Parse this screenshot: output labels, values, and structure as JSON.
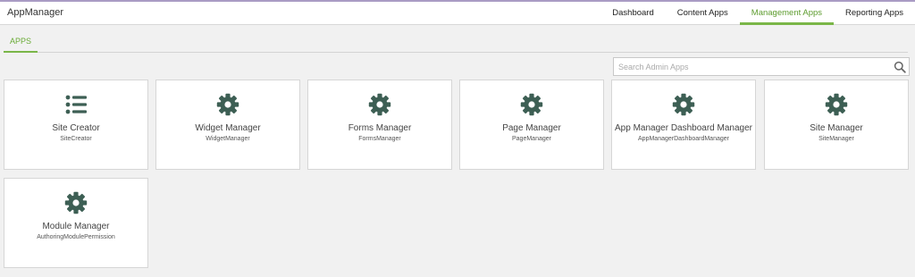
{
  "app": {
    "title": "AppManager"
  },
  "nav": {
    "items": [
      {
        "label": "Dashboard",
        "active": false
      },
      {
        "label": "Content Apps",
        "active": false
      },
      {
        "label": "Management Apps",
        "active": true
      },
      {
        "label": "Reporting Apps",
        "active": false
      }
    ]
  },
  "subtabs": {
    "apps": "APPS"
  },
  "search": {
    "placeholder": "Search Admin Apps",
    "value": ""
  },
  "colors": {
    "accent": "#7ab648",
    "icon": "#3d5f54",
    "topBorder": "#a99bc4"
  },
  "apps": [
    {
      "name": "Site Creator",
      "code": "SiteCreator",
      "icon": "list-icon"
    },
    {
      "name": "Widget Manager",
      "code": "WidgetManager",
      "icon": "gear-icon"
    },
    {
      "name": "Forms Manager",
      "code": "FormsManager",
      "icon": "gear-icon"
    },
    {
      "name": "Page Manager",
      "code": "PageManager",
      "icon": "gear-icon"
    },
    {
      "name": "App Manager Dashboard Manager",
      "code": "AppManagerDashboardManager",
      "icon": "gear-icon"
    },
    {
      "name": "Site Manager",
      "code": "SiteManager",
      "icon": "gear-icon"
    },
    {
      "name": "Module Manager",
      "code": "AuthoringModulePermission",
      "icon": "gear-icon"
    }
  ]
}
